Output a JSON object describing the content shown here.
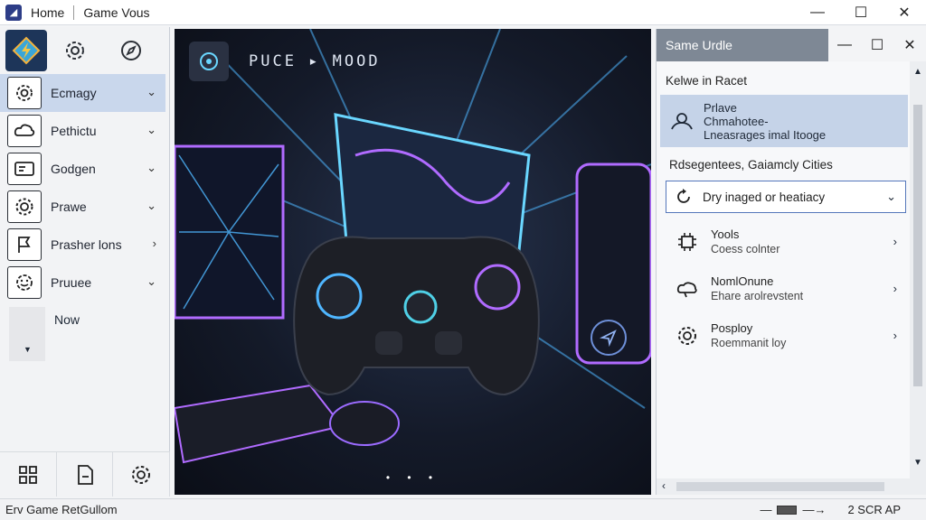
{
  "titlebar": {
    "tabs": [
      "Home",
      "Game Vous"
    ],
    "controls": {
      "minimize": "—",
      "maximize": "☐",
      "close": "✕"
    }
  },
  "sidebar": {
    "top_icons": [
      "game-logo-icon",
      "gear-icon",
      "compass-icon"
    ],
    "items": [
      {
        "label": "Ecmagy",
        "icon": "gear-icon",
        "chevron": "⌄",
        "active": true
      },
      {
        "label": "Pethictu",
        "icon": "cloud-icon",
        "chevron": "⌄"
      },
      {
        "label": "Godgen",
        "icon": "card-icon",
        "chevron": "⌄"
      },
      {
        "label": "Prawe",
        "icon": "cog-icon",
        "chevron": "⌄"
      },
      {
        "label": "Prasher lons",
        "icon": "flag-icon",
        "chevron": "›"
      },
      {
        "label": "Pruuee",
        "icon": "smiley-icon",
        "chevron": "⌄"
      }
    ],
    "now_label": "Now",
    "bottom_icons": [
      "grid-icon",
      "document-icon",
      "settings-icon"
    ]
  },
  "stage": {
    "title": "PUCE ▸ MOOD",
    "pager_dots": "• • •"
  },
  "panel": {
    "title": "Same Urdle",
    "subtitle": "Kelwe in Racet",
    "card": {
      "line1": "Prlave",
      "line2": "Chmahotee-",
      "line3": "Lneasrages imal Itooge"
    },
    "section_label": "Rdsegentees, Gaiamcly Cities",
    "select": {
      "label": "Dry inaged or heatiacy",
      "chevron": "⌄"
    },
    "rows": [
      {
        "title": "Yools",
        "sub": "Coess colnter",
        "icon": "chip-icon"
      },
      {
        "title": "NomlOnune",
        "sub": "Ehare arolrevstent",
        "icon": "cloud-hand-icon"
      },
      {
        "title": "Posploy",
        "sub": "Roemmanit loy",
        "icon": "gear-icon"
      }
    ],
    "chevron": "›"
  },
  "statusbar": {
    "left": "Erv Game RetGullom",
    "right": "2 SCR AP"
  },
  "colors": {
    "accent": "#5577bb",
    "active_item": "#c9d7ec",
    "stage_bg": "#141a29",
    "neon_blue": "#4fb6ff",
    "neon_purple": "#b06bff"
  }
}
